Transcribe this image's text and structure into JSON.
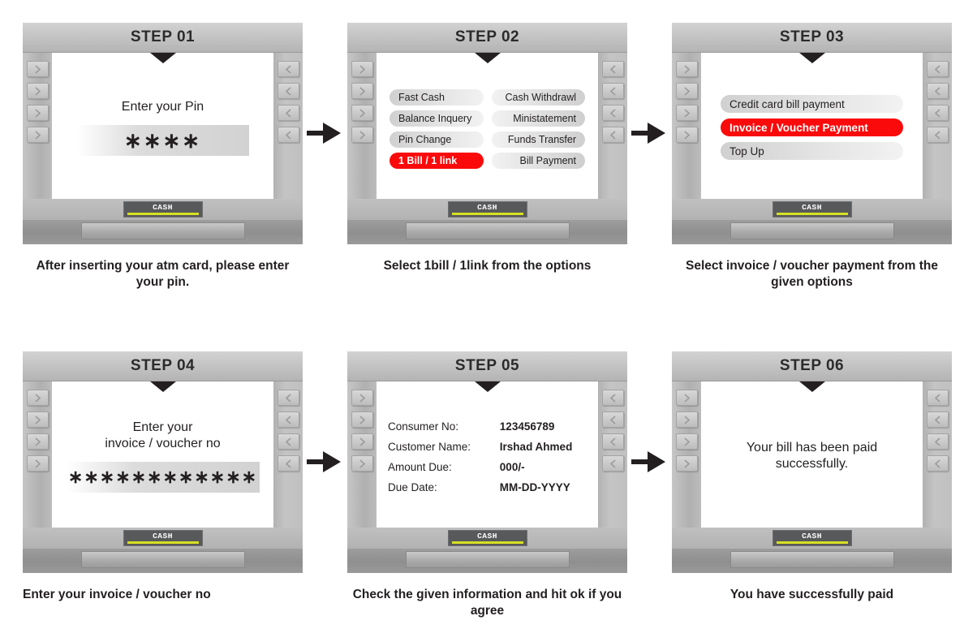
{
  "steps": [
    {
      "title": "STEP 01",
      "screen_type": "prompt",
      "prompt": "Enter your Pin",
      "field_value": "∗∗∗∗",
      "cash_label": "CASH",
      "caption": "After inserting your atm card, please enter your pin."
    },
    {
      "title": "STEP 02",
      "screen_type": "menu-grid",
      "menu_items": [
        {
          "label": "Fast Cash",
          "align": "left",
          "highlight": false
        },
        {
          "label": "Cash Withdrawl",
          "align": "right",
          "highlight": false
        },
        {
          "label": "Balance Inquery",
          "align": "left",
          "highlight": false
        },
        {
          "label": "Ministatement",
          "align": "right",
          "highlight": false
        },
        {
          "label": "Pin Change",
          "align": "left",
          "highlight": false
        },
        {
          "label": "Funds Transfer",
          "align": "right",
          "highlight": false
        },
        {
          "label": "1 Bill / 1 link",
          "align": "left",
          "highlight": true
        },
        {
          "label": "Bill Payment",
          "align": "right",
          "highlight": false
        }
      ],
      "cash_label": "CASH",
      "caption": "Select 1bill / 1link from the options"
    },
    {
      "title": "STEP 03",
      "screen_type": "menu-single",
      "menu_items": [
        {
          "label": "Credit card bill payment",
          "align": "left",
          "highlight": false
        },
        {
          "label": "Invoice / Voucher Payment",
          "align": "left",
          "highlight": true
        },
        {
          "label": "Top Up",
          "align": "left",
          "highlight": false
        }
      ],
      "cash_label": "CASH",
      "caption": "Select invoice / voucher payment from the given options"
    },
    {
      "title": "STEP 04",
      "screen_type": "prompt",
      "prompt": "Enter your\ninvoice / voucher no",
      "field_value": "∗∗∗∗∗∗∗∗∗∗∗∗",
      "cash_label": "CASH",
      "caption": "Enter your invoice / voucher no"
    },
    {
      "title": "STEP 05",
      "screen_type": "details",
      "details": [
        {
          "label": "Consumer No:",
          "value": "123456789"
        },
        {
          "label": "Customer Name:",
          "value": "Irshad Ahmed"
        },
        {
          "label": "Amount Due:",
          "value": "000/-"
        },
        {
          "label": "Due Date:",
          "value": "MM-DD-YYYY"
        }
      ],
      "cash_label": "CASH",
      "caption": "Check the given information and hit ok if you agree"
    },
    {
      "title": "STEP 06",
      "screen_type": "prompt",
      "prompt": "Your bill has been paid successfully.",
      "field_value": "",
      "cash_label": "CASH",
      "caption": "You have successfully paid"
    }
  ],
  "colors": {
    "highlight": "#fa0a0a",
    "cash_bar": "#d7e022",
    "cash_slot": "#58595b",
    "text": "#231f20"
  }
}
